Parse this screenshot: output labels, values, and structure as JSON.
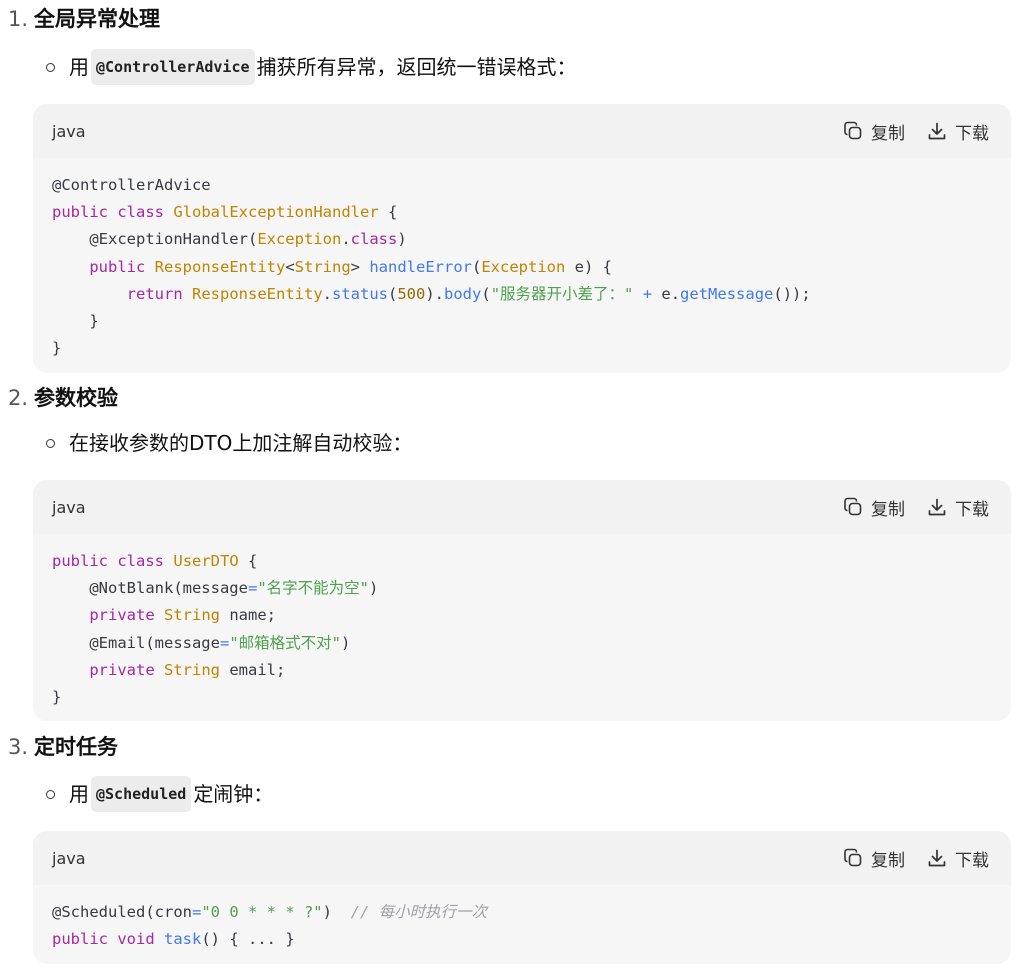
{
  "sections": [
    {
      "number": "1.",
      "title": "全局异常处理",
      "bullet": {
        "before": "用",
        "code": "@ControllerAdvice",
        "after": "捕获所有异常，返回统一错误格式："
      },
      "code_block": {
        "language": "java",
        "copy_label": "复制",
        "download_label": "下载",
        "lines": [
          [
            {
              "t": "@ControllerAdvice",
              "c": "p"
            }
          ],
          [
            {
              "t": "public",
              "c": "k"
            },
            {
              "t": " ",
              "c": "p"
            },
            {
              "t": "class",
              "c": "k"
            },
            {
              "t": " ",
              "c": "p"
            },
            {
              "t": "GlobalExceptionHandler",
              "c": "t"
            },
            {
              "t": " {",
              "c": "p"
            }
          ],
          [
            {
              "t": "    @ExceptionHandler(",
              "c": "p"
            },
            {
              "t": "Exception",
              "c": "t"
            },
            {
              "t": ".",
              "c": "p"
            },
            {
              "t": "class",
              "c": "k"
            },
            {
              "t": ")",
              "c": "p"
            }
          ],
          [
            {
              "t": "    ",
              "c": "p"
            },
            {
              "t": "public",
              "c": "k"
            },
            {
              "t": " ",
              "c": "p"
            },
            {
              "t": "ResponseEntity",
              "c": "t"
            },
            {
              "t": "<",
              "c": "p"
            },
            {
              "t": "String",
              "c": "t"
            },
            {
              "t": "> ",
              "c": "p"
            },
            {
              "t": "handleError",
              "c": "f"
            },
            {
              "t": "(",
              "c": "p"
            },
            {
              "t": "Exception",
              "c": "t"
            },
            {
              "t": " e) {",
              "c": "p"
            }
          ],
          [
            {
              "t": "        ",
              "c": "p"
            },
            {
              "t": "return",
              "c": "k"
            },
            {
              "t": " ",
              "c": "p"
            },
            {
              "t": "ResponseEntity",
              "c": "t"
            },
            {
              "t": ".",
              "c": "p"
            },
            {
              "t": "status",
              "c": "f"
            },
            {
              "t": "(",
              "c": "p"
            },
            {
              "t": "500",
              "c": "n"
            },
            {
              "t": ").",
              "c": "p"
            },
            {
              "t": "body",
              "c": "f"
            },
            {
              "t": "(",
              "c": "p"
            },
            {
              "t": "\"服务器开小差了：\"",
              "c": "s"
            },
            {
              "t": " ",
              "c": "p"
            },
            {
              "t": "+",
              "c": "o"
            },
            {
              "t": " e.",
              "c": "p"
            },
            {
              "t": "getMessage",
              "c": "f"
            },
            {
              "t": "());",
              "c": "p"
            }
          ],
          [
            {
              "t": "    }",
              "c": "p"
            }
          ],
          [
            {
              "t": "}",
              "c": "p"
            }
          ]
        ]
      }
    },
    {
      "number": "2.",
      "title": "参数校验",
      "bullet": {
        "before": "在接收参数的DTO上加注解自动校验：",
        "code": "",
        "after": ""
      },
      "code_block": {
        "language": "java",
        "copy_label": "复制",
        "download_label": "下载",
        "lines": [
          [
            {
              "t": "public",
              "c": "k"
            },
            {
              "t": " ",
              "c": "p"
            },
            {
              "t": "class",
              "c": "k"
            },
            {
              "t": " ",
              "c": "p"
            },
            {
              "t": "UserDTO",
              "c": "t"
            },
            {
              "t": " {",
              "c": "p"
            }
          ],
          [
            {
              "t": "    @NotBlank(message",
              "c": "p"
            },
            {
              "t": "=",
              "c": "o"
            },
            {
              "t": "\"名字不能为空\"",
              "c": "s"
            },
            {
              "t": ")",
              "c": "p"
            }
          ],
          [
            {
              "t": "    ",
              "c": "p"
            },
            {
              "t": "private",
              "c": "k"
            },
            {
              "t": " ",
              "c": "p"
            },
            {
              "t": "String",
              "c": "t"
            },
            {
              "t": " name;",
              "c": "p"
            }
          ],
          [
            {
              "t": "    @Email(message",
              "c": "p"
            },
            {
              "t": "=",
              "c": "o"
            },
            {
              "t": "\"邮箱格式不对\"",
              "c": "s"
            },
            {
              "t": ")",
              "c": "p"
            }
          ],
          [
            {
              "t": "    ",
              "c": "p"
            },
            {
              "t": "private",
              "c": "k"
            },
            {
              "t": " ",
              "c": "p"
            },
            {
              "t": "String",
              "c": "t"
            },
            {
              "t": " email;",
              "c": "p"
            }
          ],
          [
            {
              "t": "}",
              "c": "p"
            }
          ]
        ]
      }
    },
    {
      "number": "3.",
      "title": "定时任务",
      "bullet": {
        "before": "用",
        "code": "@Scheduled",
        "after": "定闹钟："
      },
      "code_block": {
        "language": "java",
        "copy_label": "复制",
        "download_label": "下载",
        "lines": [
          [
            {
              "t": "@Scheduled(cron",
              "c": "p"
            },
            {
              "t": "=",
              "c": "o"
            },
            {
              "t": "\"0 0 * * * ?\"",
              "c": "s"
            },
            {
              "t": ")  ",
              "c": "p"
            },
            {
              "t": "// 每小时执行一次",
              "c": "c"
            }
          ],
          [
            {
              "t": "public",
              "c": "k"
            },
            {
              "t": " ",
              "c": "p"
            },
            {
              "t": "void",
              "c": "k"
            },
            {
              "t": " ",
              "c": "p"
            },
            {
              "t": "task",
              "c": "f"
            },
            {
              "t": "() { ... }",
              "c": "p"
            }
          ]
        ]
      }
    }
  ],
  "icons": {
    "copy": "copy-icon",
    "download": "download-icon"
  },
  "colors": {
    "keyword": "#a626a4",
    "type": "#c18401",
    "function": "#4078f2",
    "string": "#50a14f",
    "number": "#986801",
    "comment": "#a0a1a7",
    "code_bg": "#f6f6f6",
    "code_header_bg": "#f2f2f2"
  }
}
